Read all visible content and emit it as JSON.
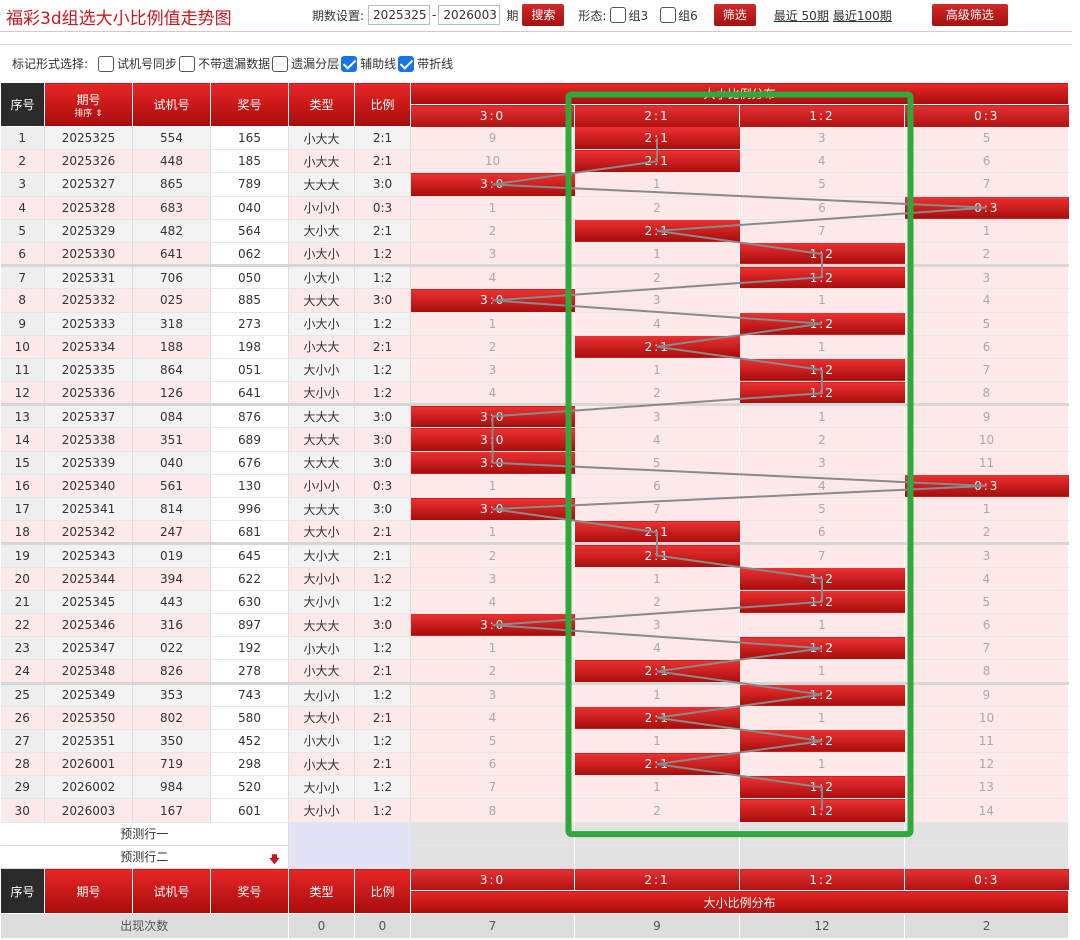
{
  "title": "福彩3d组选大小比例值走势图",
  "controls": {
    "period_label": "期数设置:",
    "start": "2025325",
    "dash": "-",
    "end": "2026003",
    "period_suffix": "期",
    "search": "搜索",
    "form_label": "形态:",
    "group3": "组3",
    "group6": "组6",
    "filter": "筛选",
    "recent50": "最近 50期",
    "recent100": "最近100期",
    "advanced": "高级筛选"
  },
  "marks": {
    "label": "标记形式选择:",
    "options": [
      {
        "text": "试机号同步",
        "checked": false
      },
      {
        "text": "不带遗漏数据",
        "checked": false
      },
      {
        "text": "遗漏分层",
        "checked": false
      },
      {
        "text": "辅助线",
        "checked": true
      },
      {
        "text": "带折线",
        "checked": true
      }
    ]
  },
  "headers": {
    "seq": "序号",
    "period": "期号",
    "sort": "排序",
    "trial": "试机号",
    "prize": "奖号",
    "type": "类型",
    "ratio": "比例",
    "dist": "大小比例分布",
    "cats": [
      "3:0",
      "2:1",
      "1:2",
      "0:3"
    ]
  },
  "rows": [
    [
      "1",
      "2025325",
      "554",
      "165",
      "小大大",
      "2:1",
      [
        9,
        "2:1",
        3,
        5
      ]
    ],
    [
      "2",
      "2025326",
      "448",
      "185",
      "小大大",
      "2:1",
      [
        10,
        "2:1",
        4,
        6
      ]
    ],
    [
      "3",
      "2025327",
      "865",
      "789",
      "大大大",
      "3:0",
      [
        "3:0",
        1,
        5,
        7
      ]
    ],
    [
      "4",
      "2025328",
      "683",
      "040",
      "小小小",
      "0:3",
      [
        1,
        2,
        6,
        "0:3"
      ]
    ],
    [
      "5",
      "2025329",
      "482",
      "564",
      "大小大",
      "2:1",
      [
        2,
        "2:1",
        7,
        1
      ]
    ],
    [
      "6",
      "2025330",
      "641",
      "062",
      "小大小",
      "1:2",
      [
        3,
        1,
        "1:2",
        2
      ]
    ],
    [
      "7",
      "2025331",
      "706",
      "050",
      "小大小",
      "1:2",
      [
        4,
        2,
        "1:2",
        3
      ]
    ],
    [
      "8",
      "2025332",
      "025",
      "885",
      "大大大",
      "3:0",
      [
        "3:0",
        3,
        1,
        4
      ]
    ],
    [
      "9",
      "2025333",
      "318",
      "273",
      "小大小",
      "1:2",
      [
        1,
        4,
        "1:2",
        5
      ]
    ],
    [
      "10",
      "2025334",
      "188",
      "198",
      "小大大",
      "2:1",
      [
        2,
        "2:1",
        1,
        6
      ]
    ],
    [
      "11",
      "2025335",
      "864",
      "051",
      "大小小",
      "1:2",
      [
        3,
        1,
        "1:2",
        7
      ]
    ],
    [
      "12",
      "2025336",
      "126",
      "641",
      "大小小",
      "1:2",
      [
        4,
        2,
        "1:2",
        8
      ]
    ],
    [
      "13",
      "2025337",
      "084",
      "876",
      "大大大",
      "3:0",
      [
        "3:0",
        3,
        1,
        9
      ]
    ],
    [
      "14",
      "2025338",
      "351",
      "689",
      "大大大",
      "3:0",
      [
        "3:0",
        4,
        2,
        10
      ]
    ],
    [
      "15",
      "2025339",
      "040",
      "676",
      "大大大",
      "3:0",
      [
        "3:0",
        5,
        3,
        11
      ]
    ],
    [
      "16",
      "2025340",
      "561",
      "130",
      "小小小",
      "0:3",
      [
        1,
        6,
        4,
        "0:3"
      ]
    ],
    [
      "17",
      "2025341",
      "814",
      "996",
      "大大大",
      "3:0",
      [
        "3:0",
        7,
        5,
        1
      ]
    ],
    [
      "18",
      "2025342",
      "247",
      "681",
      "大大小",
      "2:1",
      [
        1,
        "2:1",
        6,
        2
      ]
    ],
    [
      "19",
      "2025343",
      "019",
      "645",
      "大小大",
      "2:1",
      [
        2,
        "2:1",
        7,
        3
      ]
    ],
    [
      "20",
      "2025344",
      "394",
      "622",
      "大小小",
      "1:2",
      [
        3,
        1,
        "1:2",
        4
      ]
    ],
    [
      "21",
      "2025345",
      "443",
      "630",
      "大小小",
      "1:2",
      [
        4,
        2,
        "1:2",
        5
      ]
    ],
    [
      "22",
      "2025346",
      "316",
      "897",
      "大大大",
      "3:0",
      [
        "3:0",
        3,
        1,
        6
      ]
    ],
    [
      "23",
      "2025347",
      "022",
      "192",
      "小大小",
      "1:2",
      [
        1,
        4,
        "1:2",
        7
      ]
    ],
    [
      "24",
      "2025348",
      "826",
      "278",
      "小大大",
      "2:1",
      [
        2,
        "2:1",
        1,
        8
      ]
    ],
    [
      "25",
      "2025349",
      "353",
      "743",
      "大小小",
      "1:2",
      [
        3,
        1,
        "1:2",
        9
      ]
    ],
    [
      "26",
      "2025350",
      "802",
      "580",
      "大大小",
      "2:1",
      [
        4,
        "2:1",
        1,
        10
      ]
    ],
    [
      "27",
      "2025351",
      "350",
      "452",
      "小大小",
      "1:2",
      [
        5,
        1,
        "1:2",
        11
      ]
    ],
    [
      "28",
      "2026001",
      "719",
      "298",
      "小大大",
      "2:1",
      [
        6,
        "2:1",
        1,
        12
      ]
    ],
    [
      "29",
      "2026002",
      "984",
      "520",
      "大小小",
      "1:2",
      [
        7,
        1,
        "1:2",
        13
      ]
    ],
    [
      "30",
      "2026003",
      "167",
      "601",
      "大小小",
      "1:2",
      [
        8,
        2,
        "1:2",
        14
      ]
    ]
  ],
  "predict": [
    "预测行一",
    "预测行二"
  ],
  "footer": {
    "count_label": "出现次数",
    "counts": [
      "0",
      "0",
      "7",
      "9",
      "12",
      "2"
    ]
  },
  "colors": {
    "brand_red": "#c8171e",
    "highlight_box": "#2fa83c"
  }
}
